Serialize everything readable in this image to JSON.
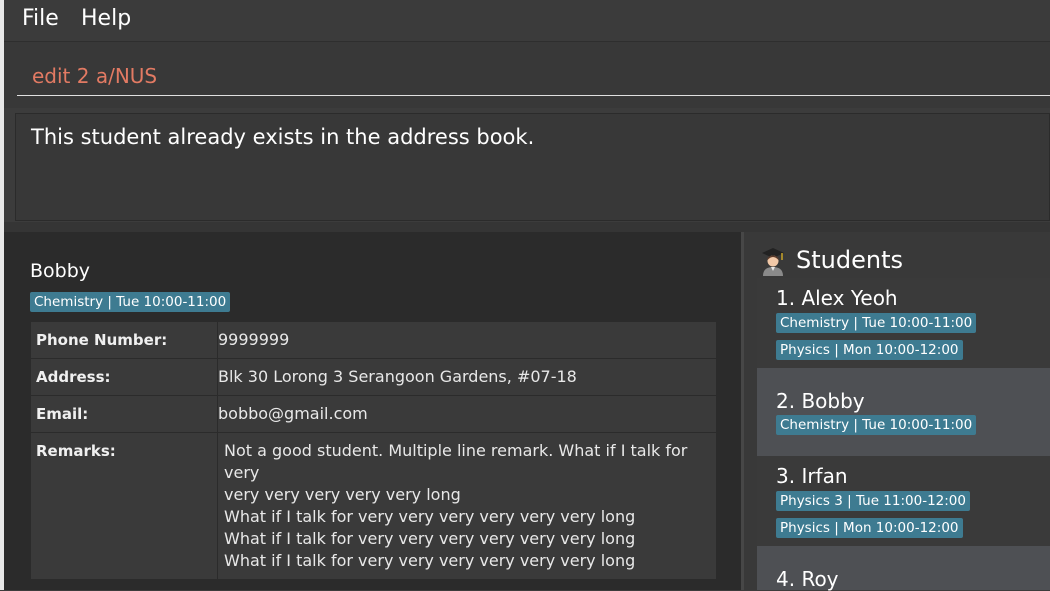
{
  "menu": {
    "file": "File",
    "help": "Help"
  },
  "command": {
    "value": "edit 2 a/NUS"
  },
  "result": {
    "message": "This student already exists in the address book."
  },
  "detail": {
    "name": "Bobby",
    "tag": "Chemistry | Tue 10:00-11:00",
    "fields": {
      "phone_label": "Phone Number:",
      "phone_value": "9999999",
      "address_label": "Address:",
      "address_value": "Blk 30 Lorong 3 Serangoon Gardens, #07-18",
      "email_label": "Email:",
      "email_value": "bobbo@gmail.com",
      "remarks_label": "Remarks:",
      "remarks_lines": [
        "Not a good student. Multiple line remark. What if I talk for very",
        "very very very very very long",
        "What if I talk for very very very very very very long",
        "What if I talk for very very very very very very long",
        "What if I talk for very very very very very very long"
      ]
    }
  },
  "list": {
    "icon": "student-graduate-icon",
    "title": "Students",
    "students": [
      {
        "name": "1.  Alex Yeoh",
        "tags": [
          "Chemistry | Tue 10:00-11:00",
          "Physics | Mon 10:00-12:00"
        ]
      },
      {
        "name": "2.  Bobby",
        "tags": [
          "Chemistry | Tue 10:00-11:00"
        ]
      },
      {
        "name": "3.  Irfan",
        "tags": [
          "Physics 3 | Tue 11:00-12:00",
          "Physics | Mon 10:00-12:00"
        ]
      },
      {
        "name": "4.  Roy",
        "tags": []
      }
    ]
  },
  "colors": {
    "tag_bg": "#3e7b91",
    "command_text": "#e27a63",
    "selected_card": "#4e5054"
  }
}
